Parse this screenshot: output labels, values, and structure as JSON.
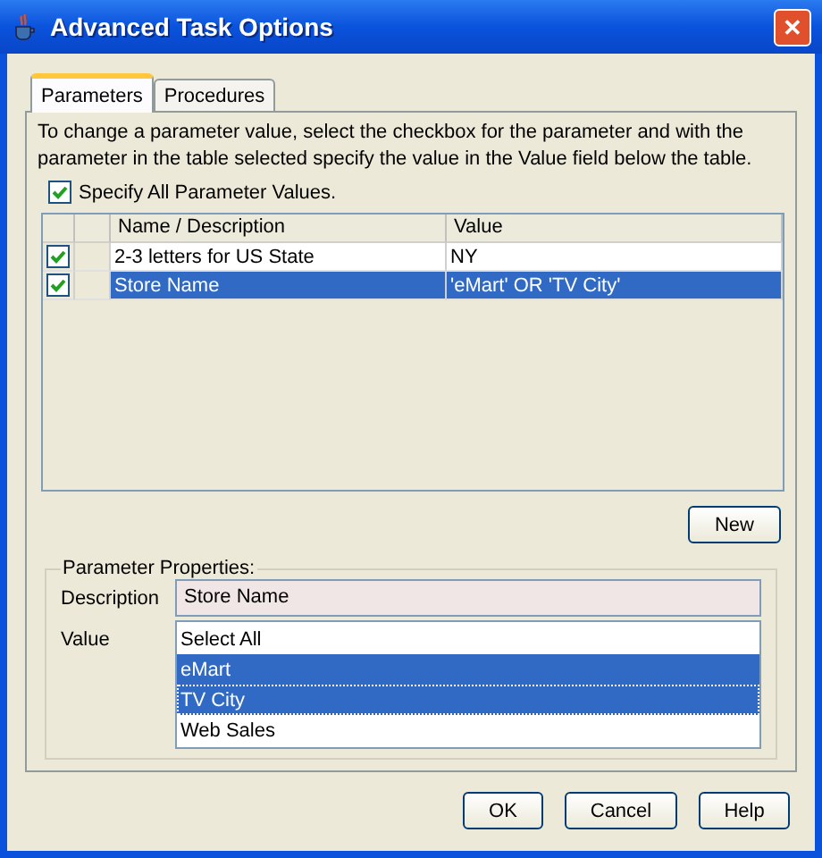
{
  "window": {
    "title": "Advanced Task Options",
    "close": "✕"
  },
  "tabs": [
    {
      "label": "Parameters",
      "selected": true
    },
    {
      "label": "Procedures",
      "selected": false
    }
  ],
  "instructions": "To change a parameter value, select the checkbox for the parameter and with the parameter in the table selected specify the value in the Value field below the table.",
  "specify_all": {
    "label": "Specify All Parameter Values.",
    "checked": true
  },
  "table": {
    "columns": [
      "Name / Description",
      "Value"
    ],
    "rows": [
      {
        "checked": true,
        "selected": false,
        "name": "2-3 letters for US State",
        "value": "NY"
      },
      {
        "checked": true,
        "selected": true,
        "name": "Store Name",
        "value": "'eMart' OR 'TV City'"
      }
    ]
  },
  "new_button": "New",
  "properties": {
    "title": "Parameter Properties:",
    "description_label": "Description",
    "description": "Store Name",
    "value_label": "Value",
    "values": [
      {
        "label": "Select All",
        "selected": false,
        "focused": false
      },
      {
        "label": "eMart",
        "selected": true,
        "focused": false
      },
      {
        "label": "TV City",
        "selected": true,
        "focused": true
      },
      {
        "label": "Web Sales",
        "selected": false,
        "focused": false
      }
    ]
  },
  "buttons": [
    "OK",
    "Cancel",
    "Help"
  ]
}
